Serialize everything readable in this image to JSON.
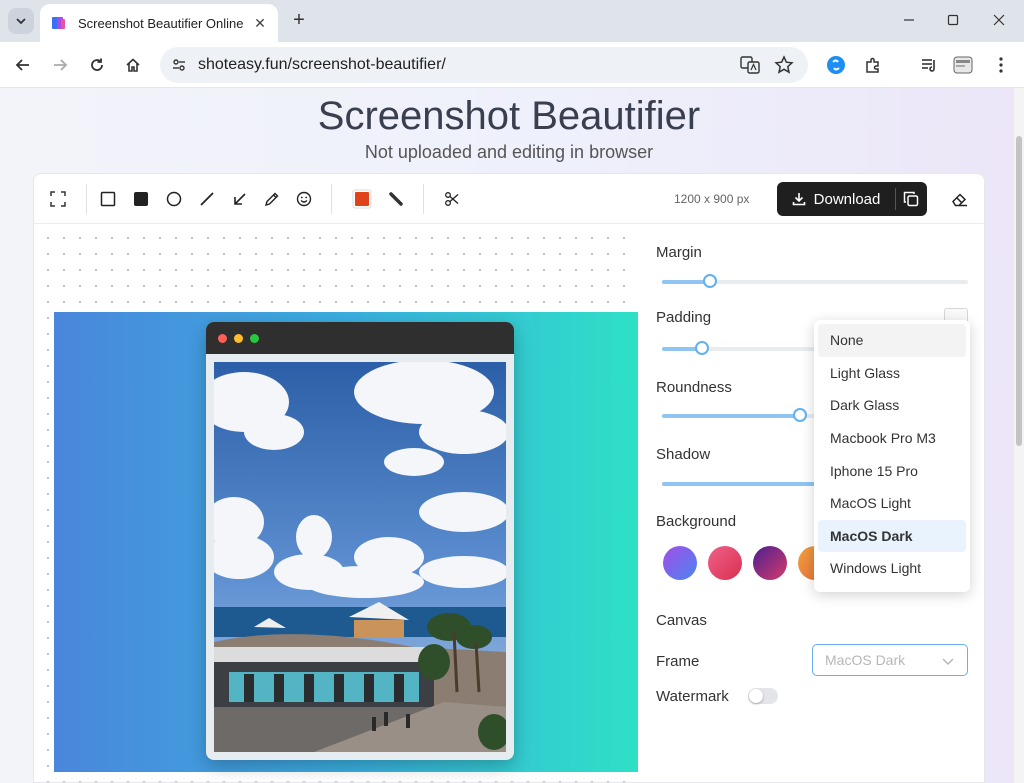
{
  "browser": {
    "tab_title": "Screenshot Beautifier Online |",
    "url": "shoteasy.fun/screenshot-beautifier/"
  },
  "page": {
    "title": "Screenshot Beautifier",
    "subtitle": "Not uploaded and editing in browser"
  },
  "editor": {
    "dimensions": "1200 x 900 px",
    "download_label": "Download"
  },
  "panel": {
    "margin_label": "Margin",
    "padding_label": "Padding",
    "roundness_label": "Roundness",
    "shadow_label": "Shadow",
    "background_label": "Background",
    "canvas_label": "Canvas",
    "frame_label": "Frame",
    "watermark_label": "Watermark",
    "frame_value": "MacOS Dark",
    "sliders": {
      "margin": 0.16,
      "padding": 0.13,
      "roundness": 0.45,
      "shadow": 0.5
    },
    "watermark_enabled": false
  },
  "frame_options": [
    "None",
    "Light Glass",
    "Dark Glass",
    "Macbook Pro M3",
    "Iphone 15 Pro",
    "MacOS Light",
    "MacOS Dark",
    "Windows Light"
  ],
  "colors": {
    "accent": "#62b1ee",
    "stroke_color": "#e0421b",
    "swatches": [
      "#7b6cf0",
      "#ee4d6a",
      "#8a2a8f",
      "#f08a3a"
    ]
  }
}
